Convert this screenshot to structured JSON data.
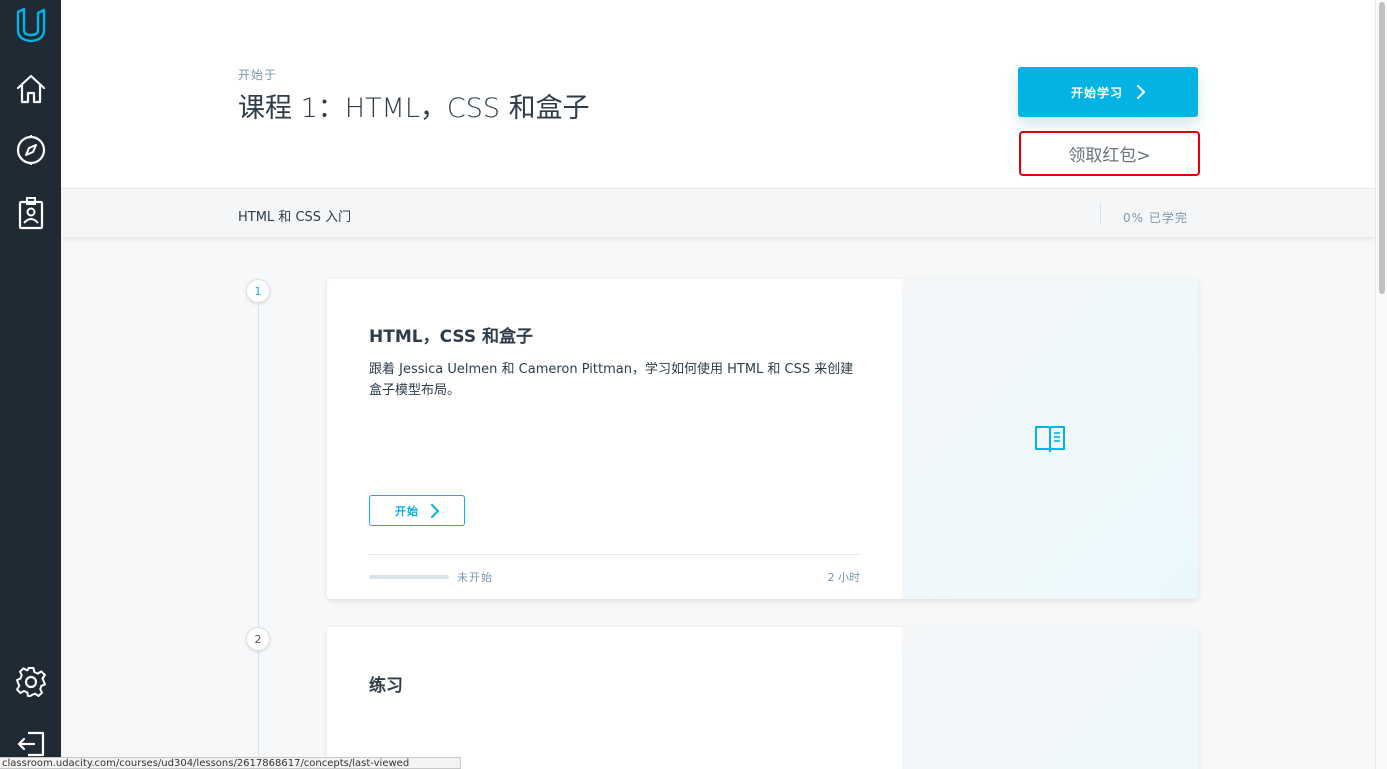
{
  "sidebar": {
    "items": [
      {
        "name": "udacity-logo-icon"
      },
      {
        "name": "home-icon"
      },
      {
        "name": "compass-icon"
      },
      {
        "name": "badge-icon"
      },
      {
        "name": "gear-icon"
      },
      {
        "name": "logout-icon"
      }
    ],
    "accent": "#02b3e4"
  },
  "header": {
    "starts_label": "开始于",
    "title": "课程 1：HTML，CSS 和盒子",
    "start_button": "开始学习",
    "redpack_link": "领取红包>"
  },
  "subbar": {
    "lesson_group": "HTML 和 CSS 入门",
    "progress": "0% 已学完"
  },
  "lessons": [
    {
      "number": "1",
      "title": "HTML，CSS 和盒子",
      "description": "跟着 Jessica Uelmen 和 Cameron Pittman，学习如何使用 HTML 和 CSS 来创建盒子模型布局。",
      "start_button": "开始",
      "progress_fraction": 0,
      "status": "未开始",
      "duration": "2 小时",
      "icon": "book-icon"
    },
    {
      "number": "2",
      "title": "练习"
    }
  ],
  "status_url": "classroom.udacity.com/courses/ud304/lessons/2617868617/concepts/last-viewed",
  "colors": {
    "primary": "#02b3e4",
    "sidebar_bg": "#1f2a35",
    "highlight_red": "#e0000f"
  }
}
